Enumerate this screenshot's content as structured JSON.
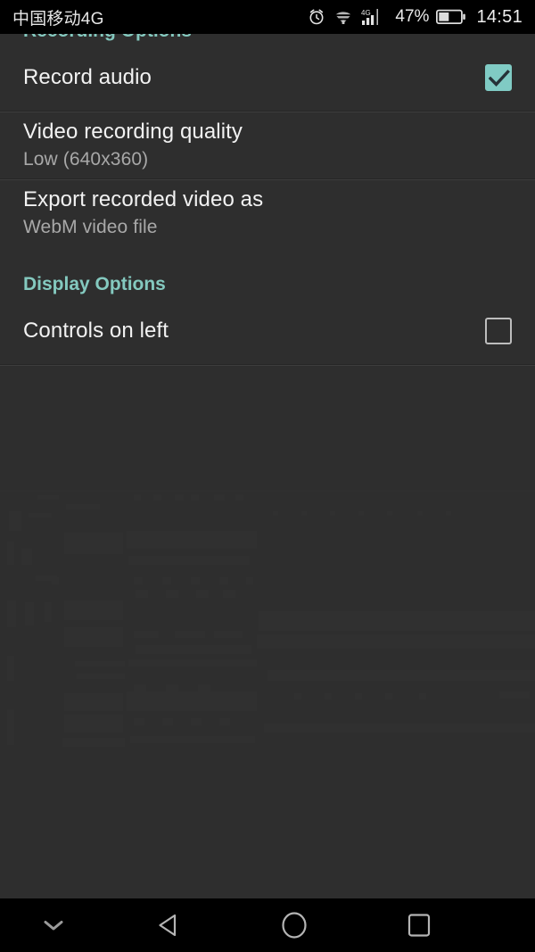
{
  "statusbar": {
    "carrier": "中国移动4G",
    "battery_percent": "47%",
    "clock": "14:51",
    "icons": [
      "alarm-icon",
      "wifi-icon",
      "signal-4g-icon",
      "battery-icon"
    ]
  },
  "screen": {
    "app_theme_accent": "#80cbc4",
    "background": "#2e2e2e"
  },
  "sections": [
    {
      "header": "Recording Options",
      "rows": [
        {
          "title": "Record audio",
          "subtitle": "",
          "control": "checkbox",
          "checked": true
        },
        {
          "title": "Video recording quality",
          "subtitle": "Low (640x360)",
          "control": "none",
          "checked": false
        },
        {
          "title": "Export recorded video as",
          "subtitle": "WebM video file",
          "control": "none",
          "checked": false
        }
      ]
    },
    {
      "header": "Display Options",
      "rows": [
        {
          "title": "Controls on left",
          "subtitle": "",
          "control": "checkbox",
          "checked": false
        }
      ]
    }
  ],
  "navbar": {
    "hide_label": "hide-navbar",
    "back_label": "back",
    "home_label": "home",
    "recents_label": "recents"
  }
}
